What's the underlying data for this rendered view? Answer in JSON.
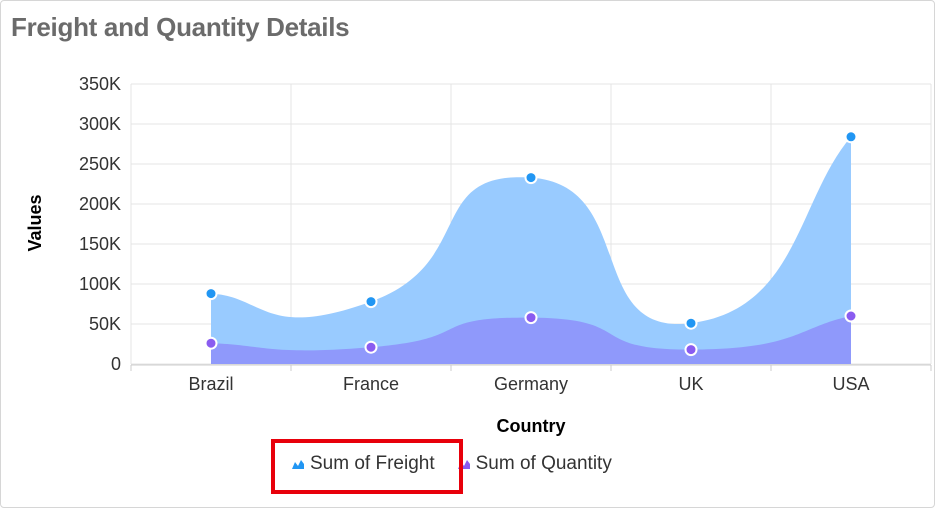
{
  "title": "Freight and Quantity Details",
  "colors": {
    "freight": "#99cbff",
    "freight_marker": "#2196f3",
    "quantity": "#8f99fb",
    "quantity_marker": "#8a5cf0",
    "highlight": "#e8000b",
    "grid": "#e4e4e4"
  },
  "legend": {
    "items": [
      {
        "label": "Sum of Freight",
        "icon": "freight-area-icon"
      },
      {
        "label": "Sum of Quantity",
        "icon": "quantity-area-icon"
      }
    ],
    "highlighted": "Sum of Freight"
  },
  "chart_data": {
    "type": "area",
    "smooth": true,
    "title": "Freight and Quantity Details",
    "xlabel": "Country",
    "ylabel": "Values",
    "categories": [
      "Brazil",
      "France",
      "Germany",
      "UK",
      "USA"
    ],
    "yticks": [
      "0",
      "50K",
      "100K",
      "150K",
      "200K",
      "250K",
      "300K",
      "350K"
    ],
    "ylim": [
      0,
      350000
    ],
    "grid": true,
    "legend_position": "bottom",
    "series": [
      {
        "name": "Sum of Freight",
        "values": [
          88000,
          78000,
          233000,
          51000,
          284000
        ]
      },
      {
        "name": "Sum of Quantity",
        "values": [
          26000,
          21000,
          58000,
          18000,
          60000
        ]
      }
    ]
  }
}
